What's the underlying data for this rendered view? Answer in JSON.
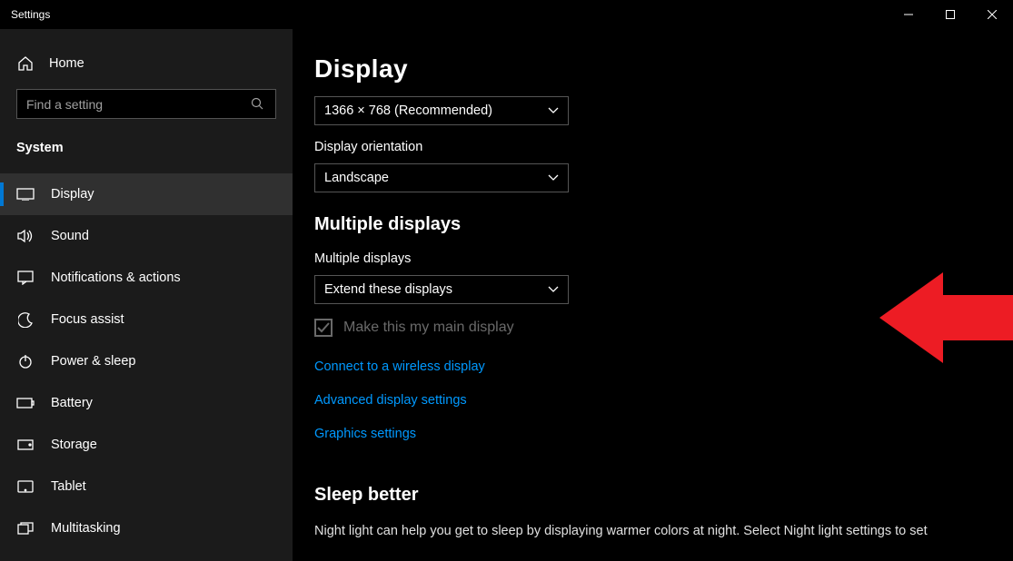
{
  "window": {
    "title": "Settings"
  },
  "sidebar": {
    "home_label": "Home",
    "search_placeholder": "Find a setting",
    "section_label": "System",
    "items": [
      {
        "label": "Display",
        "active": true
      },
      {
        "label": "Sound"
      },
      {
        "label": "Notifications & actions"
      },
      {
        "label": "Focus assist"
      },
      {
        "label": "Power & sleep"
      },
      {
        "label": "Battery"
      },
      {
        "label": "Storage"
      },
      {
        "label": "Tablet"
      },
      {
        "label": "Multitasking"
      }
    ]
  },
  "main": {
    "title": "Display",
    "resolution_value": "1366 × 768 (Recommended)",
    "orientation_label": "Display orientation",
    "orientation_value": "Landscape",
    "multiple_heading": "Multiple displays",
    "multiple_label": "Multiple displays",
    "multiple_value": "Extend these displays",
    "main_display_label": "Make this my main display",
    "link_wireless": "Connect to a wireless display",
    "link_advanced": "Advanced display settings",
    "link_graphics": "Graphics settings",
    "sleep_heading": "Sleep better",
    "sleep_desc": "Night light can help you get to sleep by displaying warmer colors at night. Select Night light settings to set"
  }
}
